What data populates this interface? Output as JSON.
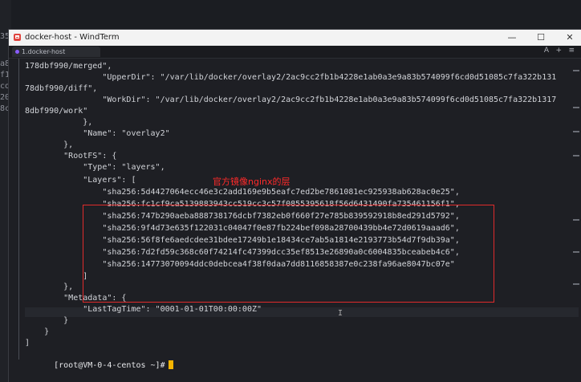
{
  "background_terminal": {
    "fragments": [
      "35",
      "a8",
      "f1",
      "co",
      "20",
      "8c"
    ]
  },
  "window": {
    "title": "docker-host - WindTerm",
    "controls": {
      "minimize": "—",
      "maximize": "☐",
      "close": "✕"
    }
  },
  "tabbar": {
    "tab_label": "1.docker-host",
    "right_icons": [
      "A",
      "+",
      "≡"
    ]
  },
  "terminal": {
    "lines": [
      "178dbf990/merged\",",
      "                \"UpperDir\": \"/var/lib/docker/overlay2/2ac9cc2fb1b4228e1ab0a3e9a83b574099f6cd0d51085c7fa322b131",
      "78dbf990/diff\",",
      "                \"WorkDir\": \"/var/lib/docker/overlay2/2ac9cc2fb1b4228e1ab0a3e9a83b574099f6cd0d51085c7fa322b1317",
      "8dbf990/work\"",
      "            },",
      "            \"Name\": \"overlay2\"",
      "        },",
      "        \"RootFS\": {",
      "            \"Type\": \"layers\",",
      "            \"Layers\": [",
      "                \"sha256:5d4427064ecc46e3c2add169e9b5eafc7ed2be7861081ec925938ab628ac0e25\",",
      "                \"sha256:fc1cf9ca5139883943cc519cc3c57f0855395618f56d6431490fa735461156f1\",",
      "                \"sha256:747b290aeba888738176dcbf7382eb0f660f27e785b839592918b8ed291d5792\",",
      "                \"sha256:9f4d73e635f122031c04047f0e87fb224bef098a28700439bb4e72d0619aaad6\",",
      "                \"sha256:56f8fe6aedcdee31bdee17249b1e18434ce7ab5a1814e2193773b54d7f9db39a\",",
      "                \"sha256:7d2fd59c368c60f74214fc47399dcc35ef8513e26890a0c6004835bceabeb4c6\",",
      "                \"sha256:14773070094ddc0debcea4f38f0daa7dd8116858387e0c238fa96ae8047bc07e\"",
      "            ]",
      "        },",
      "        \"Metadata\": {",
      "            \"LastTagTime\": \"0001-01-01T00:00:00Z\"",
      "        }",
      "    }",
      "]"
    ],
    "annotation": "官方镜像nginx的层",
    "prompt": "[root@VM-0-4-centos ~]#"
  }
}
